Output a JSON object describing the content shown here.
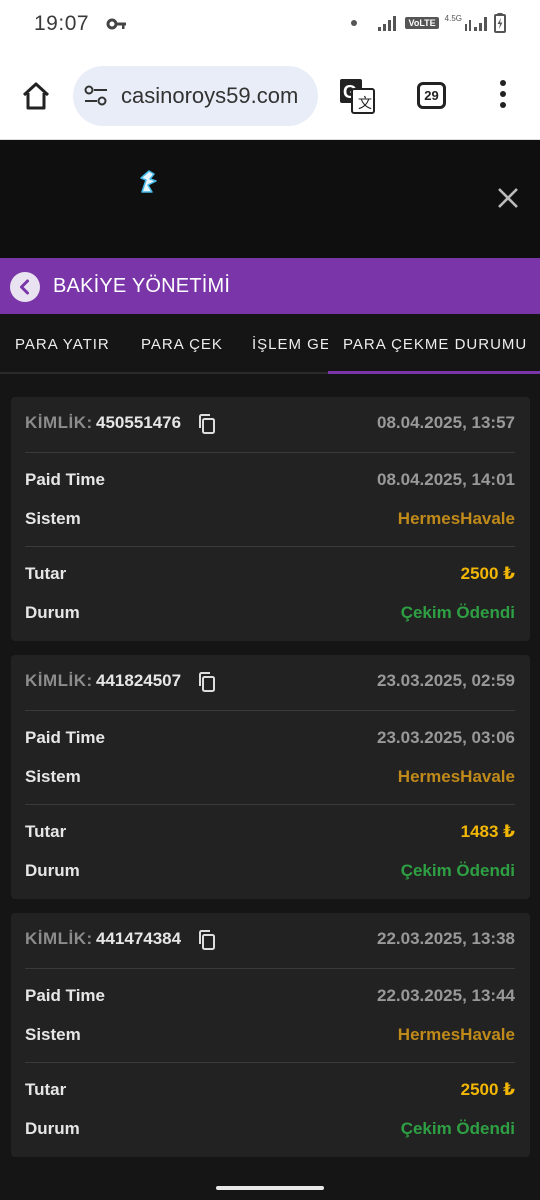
{
  "status_bar": {
    "time": "19:07",
    "volte": "VoLTE",
    "network": "4.5G"
  },
  "browser": {
    "url": "casinoroys59.com",
    "tab_count": "29"
  },
  "header": {
    "title": "BAKİYE YÖNETİMİ"
  },
  "tabs": [
    {
      "label": "PARA YATIR"
    },
    {
      "label": "PARA ÇEK"
    },
    {
      "label": "İŞLEM GEÇMİŞİ"
    },
    {
      "label": "PARA ÇEKME DURUMU"
    }
  ],
  "labels": {
    "id": "KİMLİK:",
    "paid_time": "Paid Time",
    "sistem": "Sistem",
    "tutar": "Tutar",
    "durum": "Durum"
  },
  "withdrawals": [
    {
      "id": "450551476",
      "date": "08.04.2025, 13:57",
      "paid_time": "08.04.2025, 14:01",
      "sistem": "HermesHavale",
      "tutar": "2500 ₺",
      "durum": "Çekim Ödendi"
    },
    {
      "id": "441824507",
      "date": "23.03.2025, 02:59",
      "paid_time": "23.03.2025, 03:06",
      "sistem": "HermesHavale",
      "tutar": "1483 ₺",
      "durum": "Çekim Ödendi"
    },
    {
      "id": "441474384",
      "date": "22.03.2025, 13:38",
      "paid_time": "22.03.2025, 13:44",
      "sistem": "HermesHavale",
      "tutar": "2500 ₺",
      "durum": "Çekim Ödendi"
    }
  ],
  "colors": {
    "accent": "#7a36a8",
    "sistem": "#c08a1a",
    "tutar": "#f2b705",
    "durum": "#2ea043"
  },
  "icons": [
    "key-icon",
    "signal-icon",
    "battery-icon",
    "home-icon",
    "tune-icon",
    "translate-icon",
    "more-vert-icon",
    "logo-icon",
    "close-icon",
    "back-icon",
    "copy-icon"
  ]
}
